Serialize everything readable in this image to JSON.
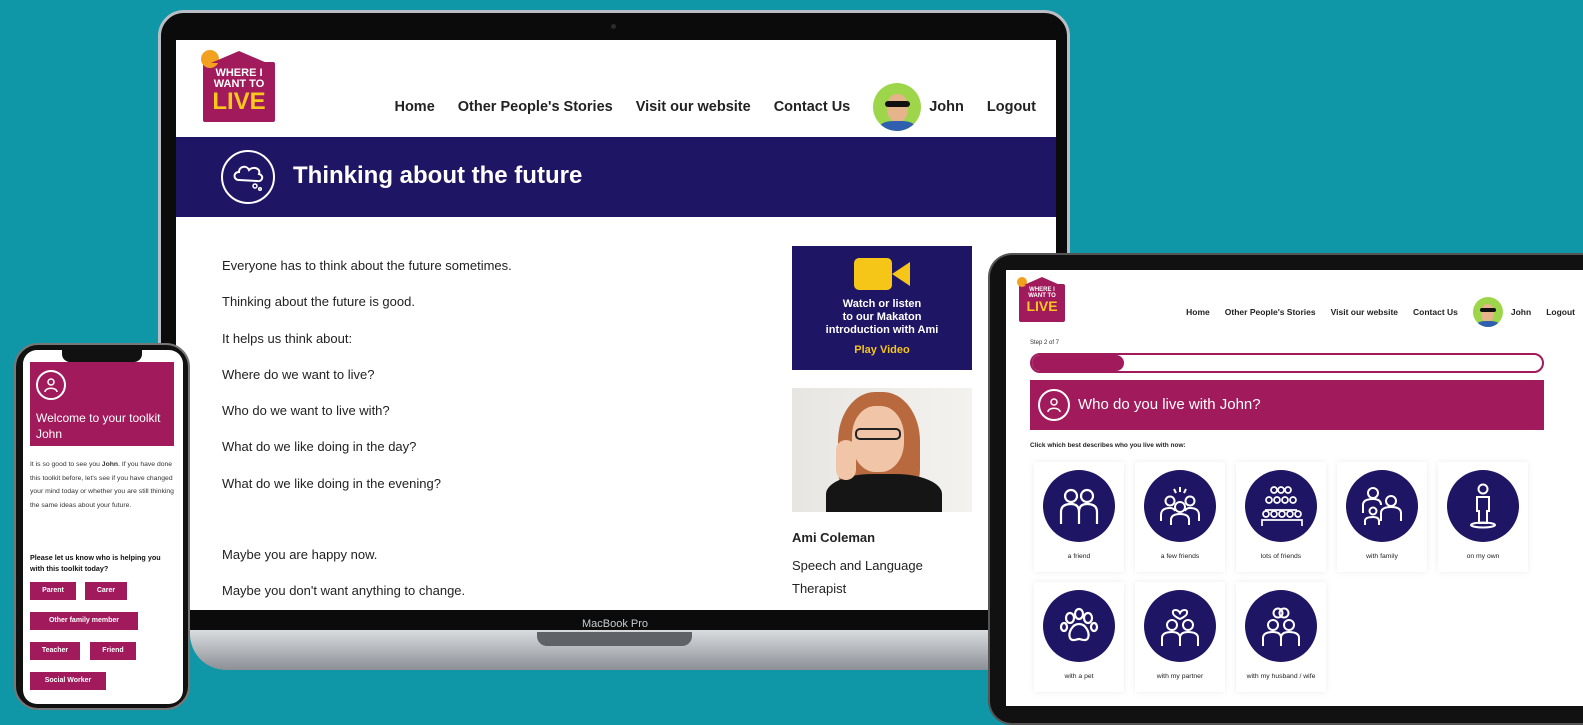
{
  "colors": {
    "background": "#0f97a8",
    "navy": "#1e1565",
    "magenta": "#a11a5b",
    "yellow": "#f5c518"
  },
  "brand": {
    "logo_line1": "WHERE I",
    "logo_line2": "WANT TO",
    "logo_line3": "LIVE"
  },
  "laptop": {
    "device_label": "MacBook Pro",
    "nav": {
      "home": "Home",
      "stories": "Other People's Stories",
      "website": "Visit our website",
      "contact": "Contact Us",
      "user": "John",
      "logout": "Logout"
    },
    "banner": {
      "title": "Thinking about the future",
      "icon": "thought-cloud-icon"
    },
    "body": [
      "Everyone has to think about the future sometimes.",
      "Thinking about the future is good.",
      "It helps us think about:",
      "Where do we want to live?",
      "Who do we want to live with?",
      "What do we like doing in the day?",
      "What do we like doing in the evening?",
      "Maybe you are happy now.",
      "Maybe you don't want anything to change."
    ],
    "video": {
      "line1": "Watch or listen",
      "line2": "to our Makaton",
      "line3": "introduction with Ami",
      "play": "Play Video",
      "icon": "video-camera-icon"
    },
    "person": {
      "name": "Ami Coleman",
      "role": "Speech and Language Therapist"
    }
  },
  "phone": {
    "welcome": "Welcome to your toolkit John",
    "intro_before": "It is so good to see you ",
    "intro_name": "John",
    "intro_after": ". If you have done this toolkit before, let's see if you have changed your mind today or whether you are still thinking the same ideas about your future.",
    "question": "Please let us know who is helping you with this toolkit today?",
    "chips": [
      "Parent",
      "Carer",
      "Other family member",
      "Teacher",
      "Friend",
      "Social Worker"
    ]
  },
  "tablet": {
    "nav": {
      "home": "Home",
      "stories": "Other People's Stories",
      "website": "Visit our website",
      "contact": "Contact Us",
      "user": "John",
      "logout": "Logout"
    },
    "step": "Step 2 of 7",
    "progress": 0.18,
    "banner": "Who do you live with John?",
    "instruction": "Click which best describes who you live with now:",
    "options": [
      {
        "label": "a friend",
        "icon": "two-people-icon"
      },
      {
        "label": "a few friends",
        "icon": "group-icon"
      },
      {
        "label": "lots of friends",
        "icon": "crowd-icon"
      },
      {
        "label": "with family",
        "icon": "family-icon"
      },
      {
        "label": "on my own",
        "icon": "single-person-icon"
      },
      {
        "label": "with a pet",
        "icon": "paw-icon"
      },
      {
        "label": "with my partner",
        "icon": "couple-heart-icon"
      },
      {
        "label": "with my husband / wife",
        "icon": "couple-rings-icon"
      }
    ]
  }
}
